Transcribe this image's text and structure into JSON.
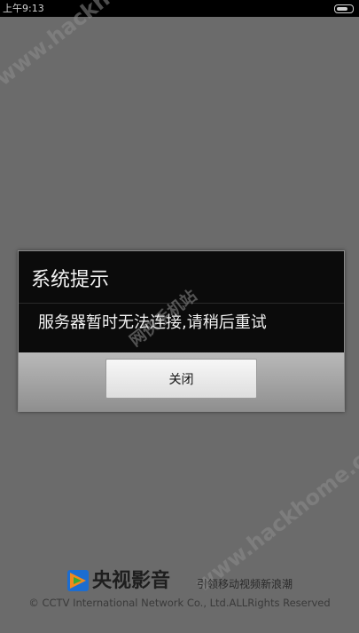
{
  "status_bar": {
    "time": "上午9:13",
    "battery_icon": "battery-icon"
  },
  "watermarks": {
    "top": "www.hackhome.com",
    "center": "网侠手机站",
    "bottom": "www.hackhome.com"
  },
  "dialog": {
    "title": "系统提示",
    "message": "服务器暂时无法连接,请稍后重试",
    "close_label": "关闭"
  },
  "footer": {
    "logo_icon": "cctv-play-icon",
    "logo_name": "央视影音",
    "slogan": "引领移动视频新浪潮",
    "copyright": "© CCTV International Network Co., Ltd.ALLRights Reserved"
  },
  "colors": {
    "background": "#6b6b6b",
    "dialog_header": "#0b0b0b",
    "logo_blue": "#1c6dd0",
    "logo_orange": "#f08a1c",
    "logo_green": "#39a935"
  }
}
